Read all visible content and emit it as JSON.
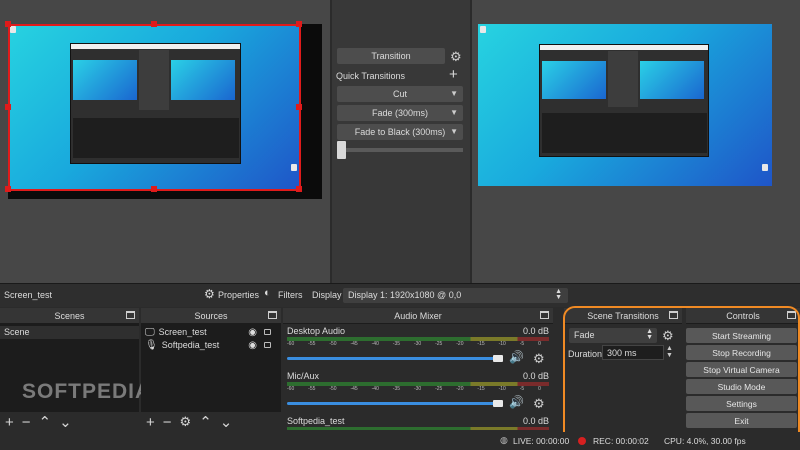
{
  "transition_panel": {
    "transition_button": "Transition",
    "quick_transitions_label": "Quick Transitions",
    "options": [
      "Cut",
      "Fade (300ms)",
      "Fade to Black (300ms)"
    ]
  },
  "scene_name_row": {
    "scene_name": "Screen_test",
    "properties_label": "Properties",
    "filters_label": "Filters",
    "display_label": "Display",
    "display_value": "Display 1: 1920x1080 @ 0,0"
  },
  "scenes": {
    "title": "Scenes",
    "items": [
      "Scene"
    ]
  },
  "sources": {
    "title": "Sources",
    "items": [
      {
        "name": "Screen_test",
        "icon": "monitor-icon"
      },
      {
        "name": "Softpedia_test",
        "icon": "microphone-icon"
      }
    ]
  },
  "audio_mixer": {
    "title": "Audio Mixer",
    "ticks": [
      "-60",
      "-55",
      "-50",
      "-45",
      "-40",
      "-35",
      "-30",
      "-25",
      "-20",
      "-15",
      "-10",
      "-5",
      "0"
    ],
    "channels": [
      {
        "name": "Desktop Audio",
        "level": "0.0 dB"
      },
      {
        "name": "Mic/Aux",
        "level": "0.0 dB"
      },
      {
        "name": "Softpedia_test",
        "level": "0.0 dB"
      }
    ]
  },
  "scene_transitions": {
    "title": "Scene Transitions",
    "selected": "Fade",
    "duration_label": "Duration",
    "duration_value": "300 ms"
  },
  "controls": {
    "title": "Controls",
    "buttons": [
      "Start Streaming",
      "Stop Recording",
      "Stop Virtual Camera",
      "Studio Mode",
      "Settings",
      "Exit"
    ]
  },
  "status_bar": {
    "live": "LIVE: 00:00:00",
    "rec": "REC: 00:00:02",
    "cpu": "CPU: 4.0%, 30.00 fps"
  },
  "watermark": "SOFTPEDIA",
  "colors": {
    "selection_red": "#e01b1b",
    "highlight_orange": "#f08a24",
    "slider_blue": "#3a8ee0",
    "rec_red": "#d62020"
  }
}
